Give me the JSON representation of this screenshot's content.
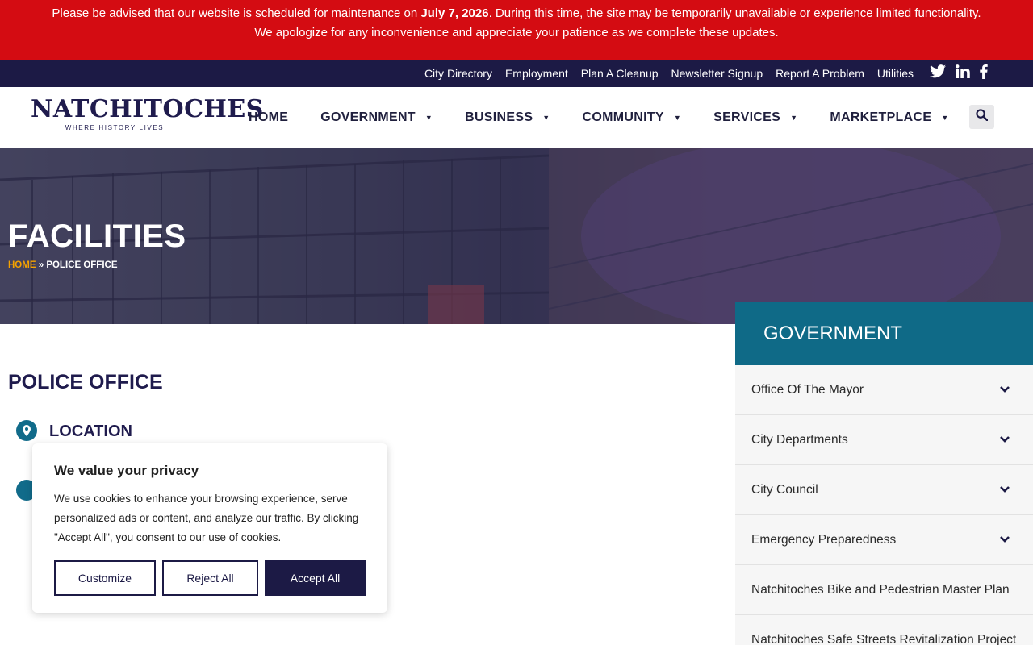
{
  "alert": {
    "line1_before": "Please be advised that our website is scheduled for maintenance on ",
    "line1_date": "July 7, 2026",
    "line1_after": ". During this time, the site may be temporarily unavailable or experience limited functionality.",
    "line2": "We apologize for any inconvenience and appreciate your patience as we complete these updates."
  },
  "utility": {
    "links": [
      "City Directory",
      "Employment",
      "Plan A Cleanup",
      "Newsletter Signup",
      "Report A Problem",
      "Utilities"
    ],
    "social_icons": [
      "twitter-icon",
      "linkedin-icon",
      "facebook-icon"
    ]
  },
  "logo": {
    "name": "NATCHITOCHES",
    "tagline": "WHERE HISTORY LIVES"
  },
  "nav": {
    "items": [
      {
        "label": "HOME",
        "dropdown": false
      },
      {
        "label": "GOVERNMENT",
        "dropdown": true
      },
      {
        "label": "BUSINESS",
        "dropdown": true
      },
      {
        "label": "COMMUNITY",
        "dropdown": true
      },
      {
        "label": "SERVICES",
        "dropdown": true
      },
      {
        "label": "MARKETPLACE",
        "dropdown": true
      }
    ],
    "search_icon": "search-icon"
  },
  "hero": {
    "title": "FACILITIES",
    "breadcrumb_home": "HOME",
    "breadcrumb_sep": "»",
    "breadcrumb_current": "POLICE OFFICE"
  },
  "main": {
    "heading": "POLICE OFFICE",
    "location_label": "LOCATION"
  },
  "sidebar": {
    "title": "GOVERNMENT",
    "items": [
      {
        "label": "Office Of The Mayor",
        "expandable": true
      },
      {
        "label": "City Departments",
        "expandable": true
      },
      {
        "label": "City Council",
        "expandable": true
      },
      {
        "label": "Emergency Preparedness",
        "expandable": true
      },
      {
        "label": "Natchitoches Bike and Pedestrian Master Plan",
        "expandable": false
      },
      {
        "label": "Natchitoches Safe Streets Revitalization Project",
        "expandable": false
      }
    ]
  },
  "cookie": {
    "title": "We value your privacy",
    "text": "We use cookies to enhance your browsing experience, serve personalized ads or content, and analyze our traffic. By clicking \"Accept All\", you consent to our use of cookies.",
    "customize": "Customize",
    "reject": "Reject All",
    "accept": "Accept All"
  },
  "colors": {
    "alert": "#d40c12",
    "navy": "#1c1a45",
    "teal": "#0f6a87",
    "breadcrumb_home": "#f5a200"
  }
}
